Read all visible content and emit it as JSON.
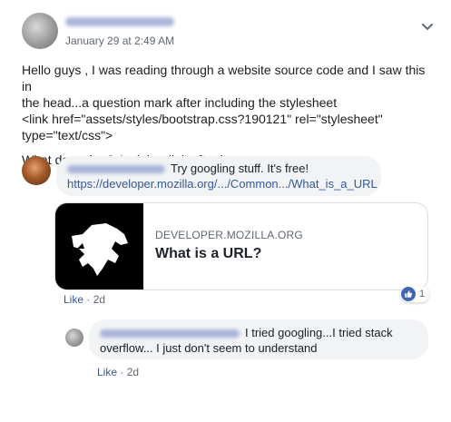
{
  "post": {
    "time": "January 29 at 2:49 AM",
    "line1": "Hello guys , I was reading through a website source code and I saw this in",
    "line2": "the head...a question mark after including the stylesheet",
    "line3": "<link href=\"assets/styles/bootstrap.css?190121\" rel=\"stylesheet\"",
    "line4": "type=\"text/css\">",
    "line5": "What does the ? And the digit after it means"
  },
  "comment1": {
    "text": "Try googling stuff. It's free!",
    "link": "https://developer.mozilla.org/.../Common.../What_is_a_URL",
    "like_label": "Like",
    "separator": " · ",
    "time": "2d",
    "reactions": "1",
    "preview": {
      "domain": "DEVELOPER.MOZILLA.ORG",
      "title": "What is a URL?"
    }
  },
  "comment2": {
    "line1": "I tried googling...I tried stack",
    "line2": "overflow... I just don't seem to understand",
    "like_label": "Like",
    "separator": " · ",
    "time": "2d"
  },
  "colors": {
    "link": "#385898",
    "bubble": "#f2f3f5",
    "like": "#4267b2"
  },
  "icons": [
    "chevron-down-icon",
    "mdn-dino-icon",
    "thumbs-up-icon"
  ]
}
